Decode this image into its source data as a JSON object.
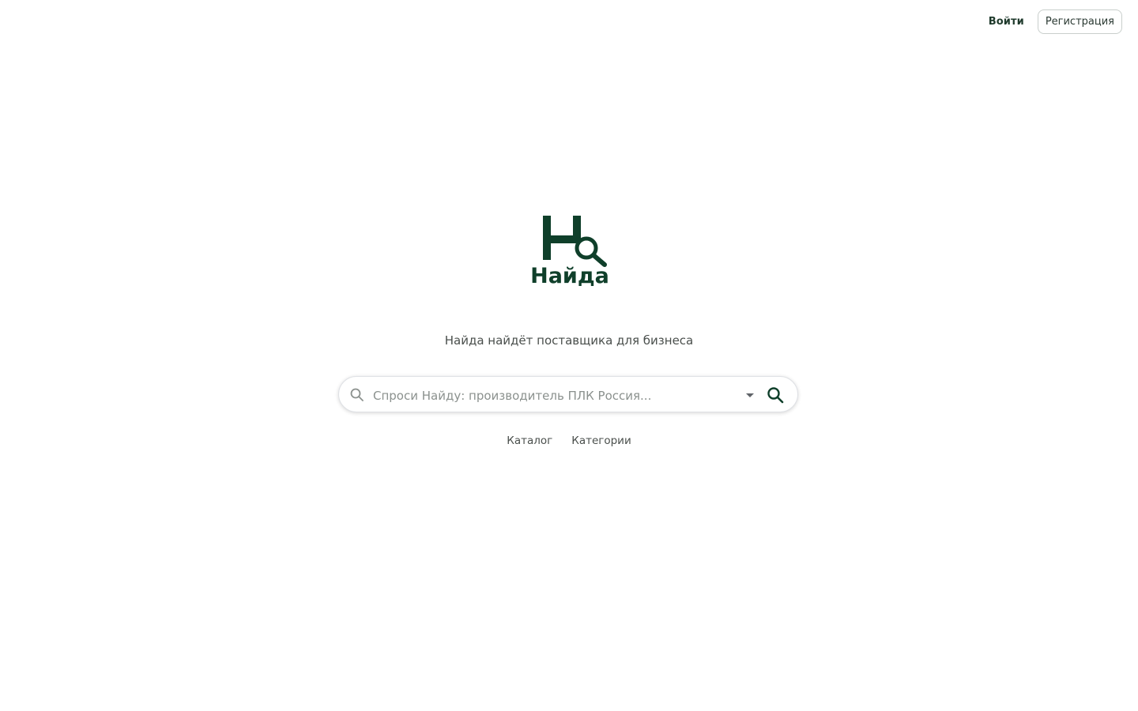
{
  "header": {
    "login_label": "Войти",
    "register_label": "Регистрация"
  },
  "logo": {
    "mark_letter": "Н",
    "wordmark": "Найда",
    "icon": "magnifier-icon",
    "color": "#0f3f2a"
  },
  "tagline": "Найда найдёт поставщика для бизнеса",
  "search": {
    "value": "",
    "placeholder": "Спроси Найду: производитель ПЛК Россия...",
    "left_icon": "search-icon",
    "dropdown_icon": "caret-down-icon",
    "submit_icon": "search-icon"
  },
  "links": {
    "catalog_label": "Каталог",
    "categories_label": "Категории"
  },
  "colors": {
    "brand": "#0f3f2a",
    "text": "#4a4f4c",
    "border": "#dfe1e5"
  }
}
